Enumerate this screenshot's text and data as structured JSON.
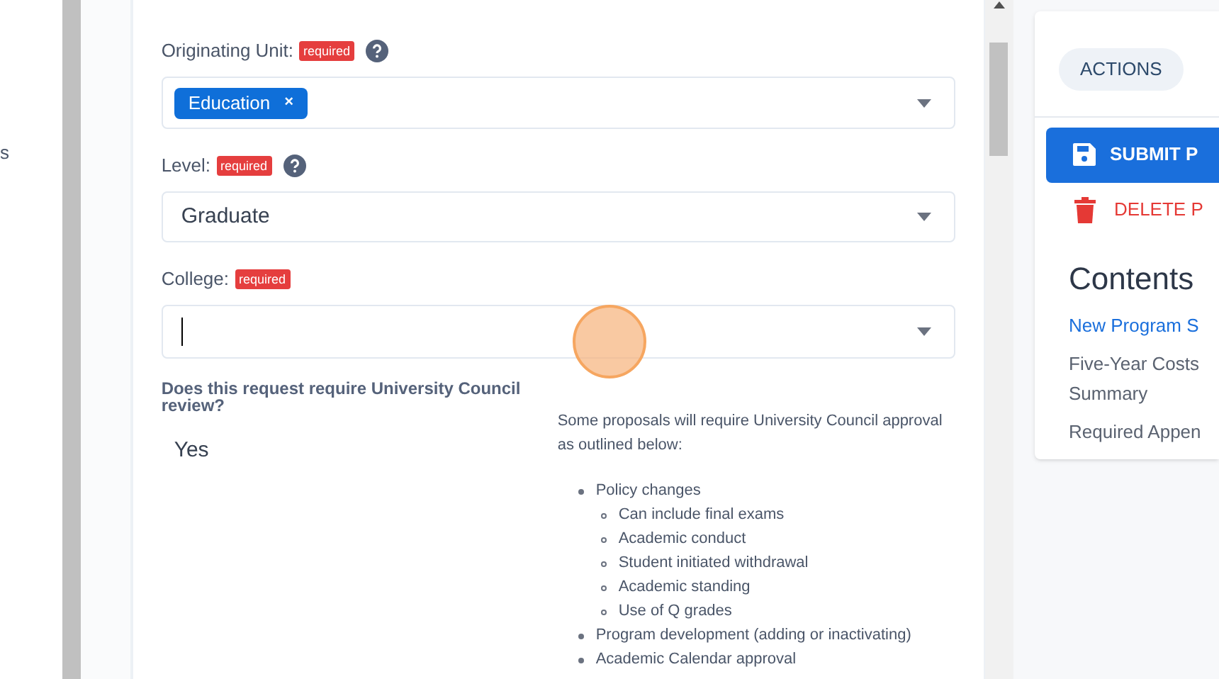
{
  "sidebar": {
    "items": [
      "s"
    ]
  },
  "form": {
    "fields": [
      {
        "kind": "tags",
        "label": "Originating Unit:",
        "required": "required",
        "help": true,
        "tags": [
          "Education"
        ],
        "tag_remove": "×"
      },
      {
        "kind": "select",
        "label": "Level:",
        "required": "required",
        "help": true,
        "value": "Graduate"
      },
      {
        "kind": "search",
        "label": "College:",
        "required": "required",
        "help": false,
        "focused": true
      }
    ],
    "question": {
      "label": "Does this request require University Council review?",
      "answer": "Yes"
    },
    "note": {
      "intro": "Some proposals will require University Council approval as outlined below:",
      "items": [
        {
          "text": "Policy changes",
          "children": [
            {
              "text": "Can include final exams"
            },
            {
              "text": "Academic conduct"
            },
            {
              "text": "Student initiated withdrawal"
            },
            {
              "text": "Academic standing"
            },
            {
              "text": "Use of Q grades"
            }
          ]
        },
        {
          "text": "Program development (adding or inactivating)"
        },
        {
          "text": "Academic Calendar approval"
        }
      ]
    }
  },
  "actions": {
    "tab": "ACTIONS",
    "buttons": [
      {
        "kind": "primary",
        "label": "SUBMIT P"
      },
      {
        "kind": "danger",
        "label": "DELETE P"
      }
    ]
  },
  "contents": {
    "title": "Contents",
    "items": [
      {
        "text": "New Program S",
        "selected": true
      },
      {
        "text": "Five-Year Costs Summary",
        "selected": false
      },
      {
        "text": "Required Appen",
        "selected": false
      }
    ]
  }
}
